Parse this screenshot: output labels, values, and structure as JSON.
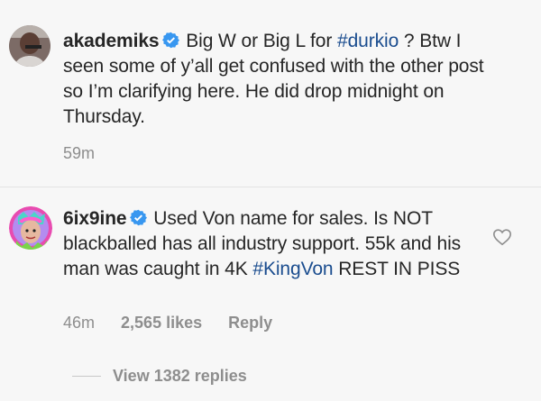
{
  "comments": [
    {
      "username": "akademiks",
      "verified": true,
      "text_before_tag1": "Big W or Big L for ",
      "tag1": "#durkio",
      "text_after_tag1": " ? Btw I seen some of y’all get confused with the other post so I’m clarifying here. He did drop midnight on Thursday.",
      "time": "59m"
    },
    {
      "username": "6ix9ine",
      "verified": true,
      "text_before_tag1": "Used Von name for sales. Is NOT blackballed has all industry support. 55k and his man was caught in 4K ",
      "tag1": "#KingVon",
      "text_after_tag1": " REST IN PISS",
      "time": "46m",
      "likes": "2,565 likes",
      "reply_label": "Reply",
      "replies_label": "View 1382 replies"
    }
  ],
  "icons": {
    "verified": "verified-badge-icon",
    "like": "heart-icon"
  },
  "colors": {
    "background": "#f7f7f7",
    "hashtag": "#1b4d8f",
    "verified": "#3897f0",
    "muted": "#8e8e8e"
  }
}
